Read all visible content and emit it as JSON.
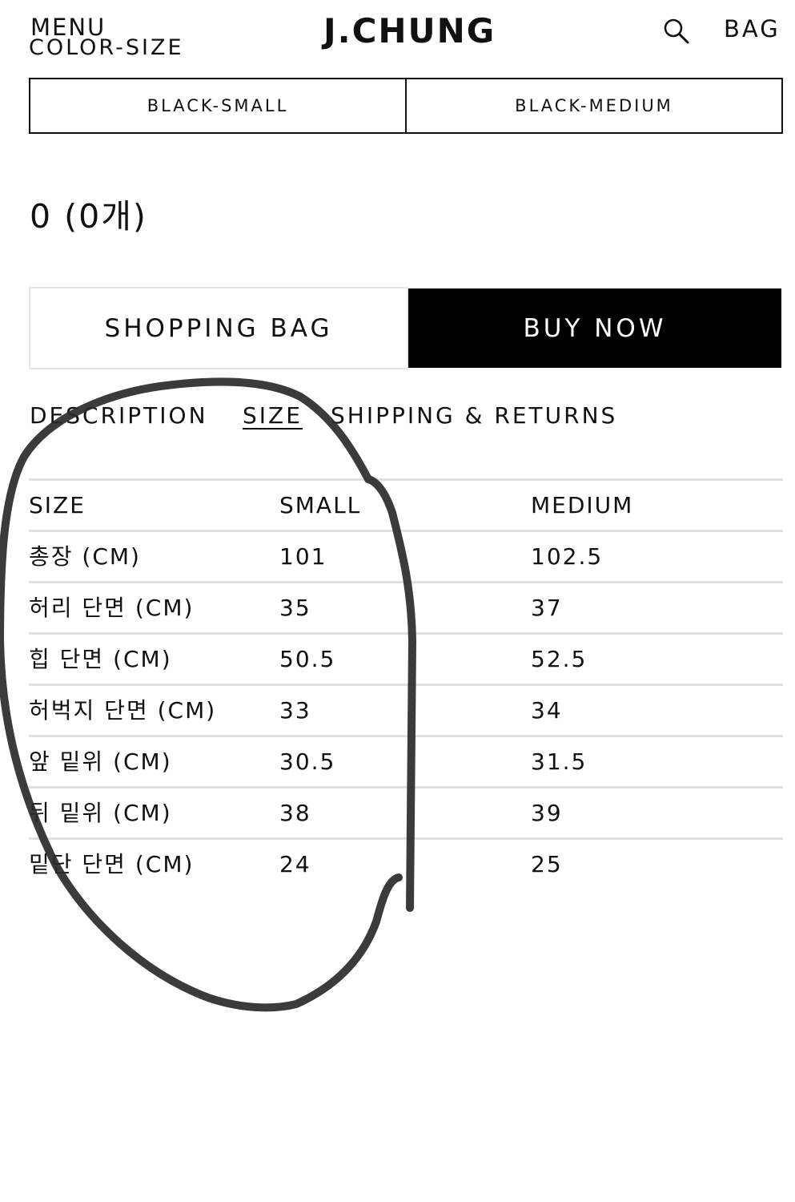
{
  "header": {
    "menu_label": "MENU",
    "color_size_label": "COLOR-SIZE",
    "logo_text": "J.CHUNG",
    "search_icon": "search-icon",
    "bag_label": "BAG"
  },
  "options": [
    {
      "label": "BLACK-SMALL"
    },
    {
      "label": "BLACK-MEDIUM"
    }
  ],
  "price_text": "0 (0개)",
  "actions": {
    "shopping_bag_label": "SHOPPING BAG",
    "buy_now_label": "BUY NOW"
  },
  "tabs": [
    {
      "label": "DESCRIPTION",
      "active": false
    },
    {
      "label": "SIZE",
      "active": true
    },
    {
      "label": "SHIPPING & RETURNS",
      "active": false
    }
  ],
  "size_table": {
    "headers": [
      "SIZE",
      "SMALL",
      "MEDIUM"
    ],
    "rows": [
      [
        "총장 (CM)",
        "101",
        "102.5"
      ],
      [
        "허리 단면 (CM)",
        "35",
        "37"
      ],
      [
        "힙 단면 (CM)",
        "50.5",
        "52.5"
      ],
      [
        "허벅지 단면 (CM)",
        "33",
        "34"
      ],
      [
        "앞 밑위 (CM)",
        "30.5",
        "31.5"
      ],
      [
        "뒤 밑위 (CM)",
        "38",
        "39"
      ],
      [
        "밑단 단면 (CM)",
        "24",
        "25"
      ]
    ]
  },
  "colors": {
    "text": "#111111",
    "buy_now_bg": "#000000",
    "divider": "#e0e0e0",
    "annotation": "#2a2a2a"
  }
}
